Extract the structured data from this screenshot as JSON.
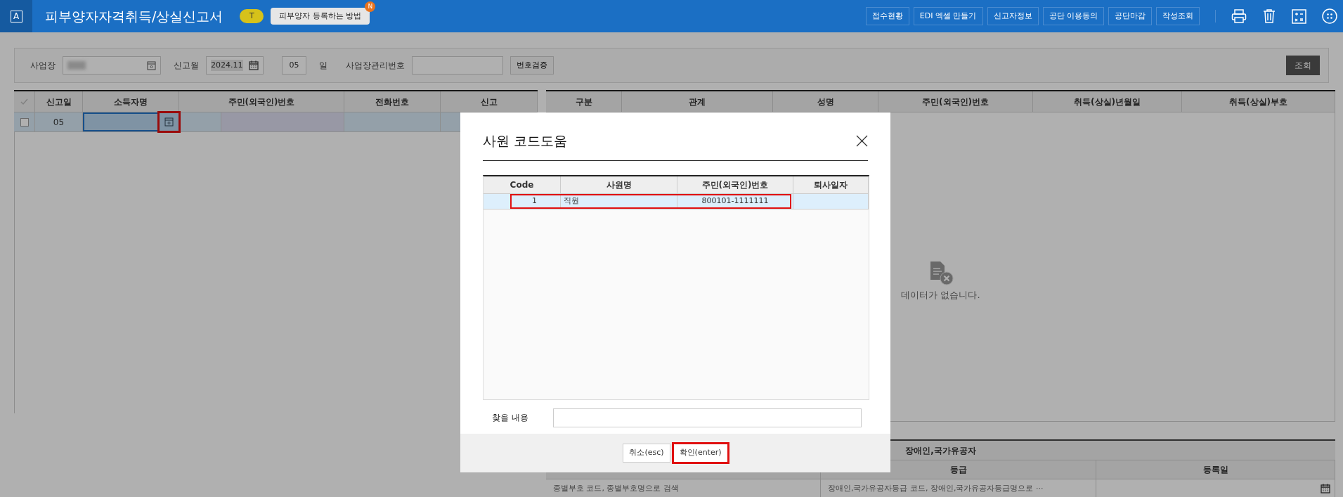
{
  "header": {
    "logo": "A",
    "title": "피부양자자격취득/상실신고서",
    "tip_badge": "T",
    "tip_text": "피부양자 등록하는 방법",
    "tip_new": "N",
    "actions": [
      "접수현황",
      "EDI 엑셀 만들기",
      "신고자정보",
      "공단 이용동의",
      "공단마감",
      "작성조회"
    ]
  },
  "filter": {
    "workplace_label": "사업장",
    "month_label": "신고월",
    "month_value": "2024.11",
    "day_value": "05",
    "day_unit": "일",
    "mgmt_label": "사업장관리번호",
    "verify_button": "번호검증",
    "search_button": "조회"
  },
  "report_table": {
    "columns": [
      "신고일",
      "소득자명",
      "주민(외국인)번호",
      "전화번호",
      "신고"
    ],
    "rows": [
      {
        "checked": false,
        "date": "05",
        "lookup_highlighted": true
      }
    ]
  },
  "family_table": {
    "columns": [
      "구분",
      "관계",
      "성명",
      "주민(외국인)번호",
      "취득(상실)년월일",
      "취득(상실)부호"
    ],
    "empty_message": "데이터가 없습니다."
  },
  "disability": {
    "title": "장애인,국가유공자",
    "columns": [
      "등급",
      "등록일"
    ],
    "placeholders": [
      "종별부호 코드, 종별부호명으로 검색",
      "장애인,국가유공자등급 코드, 장애인,국가유공자등급명으로 ···"
    ]
  },
  "dialog": {
    "title": "사원 코드도움",
    "columns": [
      "Code",
      "사원명",
      "주민(외국인)번호",
      "퇴사일자"
    ],
    "rows": [
      {
        "code": "1",
        "name": "직원",
        "id_no": "800101-1111111",
        "selected": true,
        "highlighted": true
      }
    ],
    "search_label": "찾을 내용",
    "buttons": [
      {
        "label": "취소(esc)",
        "highlighted": false
      },
      {
        "label": "확인(enter)",
        "highlighted": true
      }
    ]
  }
}
